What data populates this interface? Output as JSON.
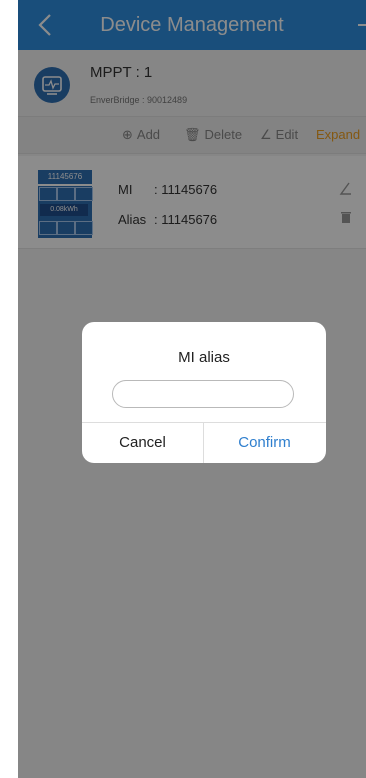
{
  "header": {
    "title": "Device Management"
  },
  "device": {
    "name": "MPPT : 1",
    "bridge": "EnverBridge : 90012489"
  },
  "actions": {
    "add": "Add",
    "delete": "Delete",
    "edit": "Edit",
    "expand": "Expand"
  },
  "card": {
    "thumb_serial": "11145676",
    "thumb_energy": "0.08kWh",
    "mi_label": "MI",
    "mi_value": ": 11145676",
    "alias_label": "Alias",
    "alias_value": ": 11145676"
  },
  "dialog": {
    "title": "MI alias",
    "input_value": "",
    "cancel": "Cancel",
    "confirm": "Confirm"
  },
  "colors": {
    "header": "#2f8fe0",
    "accent_blue": "#2f7fce",
    "expand_orange": "#f0a020"
  },
  "icons": [
    "back-chevron-icon",
    "add-icon",
    "device-monitor-icon",
    "circle-plus-icon",
    "trash-icon",
    "edit-pencil-icon"
  ]
}
